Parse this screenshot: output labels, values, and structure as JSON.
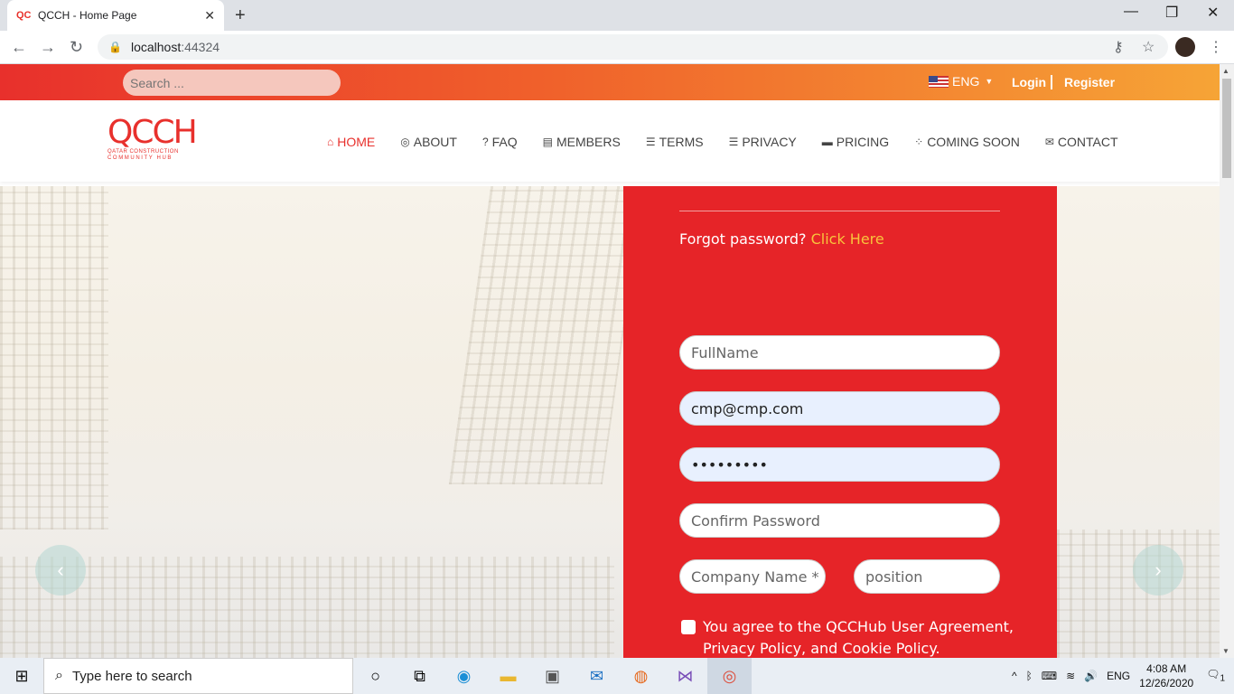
{
  "browser": {
    "tab_title": "QCCH - Home Page",
    "url_host": "localhost",
    "url_port": ":44324",
    "icons": [
      "back-icon",
      "forward-icon",
      "reload-icon",
      "lock-icon",
      "key-icon",
      "star-icon",
      "menu-icon"
    ]
  },
  "topbar": {
    "search_placeholder": "Search ...",
    "language": "ENG",
    "login": "Login",
    "register": "Register"
  },
  "logo": {
    "mark": "QCCH",
    "line1": "QATAR CONSTRUCTION",
    "line2": "COMMUNITY HUB"
  },
  "nav": {
    "items": [
      {
        "label": "HOME",
        "icon": "⌂"
      },
      {
        "label": "ABOUT",
        "icon": "◎"
      },
      {
        "label": "FAQ",
        "icon": "?"
      },
      {
        "label": "MEMBERS",
        "icon": "▤"
      },
      {
        "label": "TERMS",
        "icon": "☰"
      },
      {
        "label": "PRIVACY",
        "icon": "☰"
      },
      {
        "label": "PRICING",
        "icon": "▬"
      },
      {
        "label": "COMING SOON",
        "icon": "⁘"
      },
      {
        "label": "CONTACT",
        "icon": "✉"
      }
    ]
  },
  "form": {
    "forgot_text": "Forgot password?",
    "forgot_link": "Click Here",
    "fullname_placeholder": "FullName",
    "email_value": "cmp@cmp.com",
    "password_value": "•••••••••",
    "confirm_placeholder": "Confirm Password",
    "company_placeholder": "Company Name *",
    "position_placeholder": "position",
    "agree_line1": "You agree to the QCCHub User Agreement,",
    "agree_line2": "Privacy Policy, and Cookie Policy."
  },
  "taskbar": {
    "search_text": "Type here to search",
    "lang": "ENG",
    "time": "4:08 AM",
    "date": "12/26/2020",
    "notif_count": "1"
  }
}
